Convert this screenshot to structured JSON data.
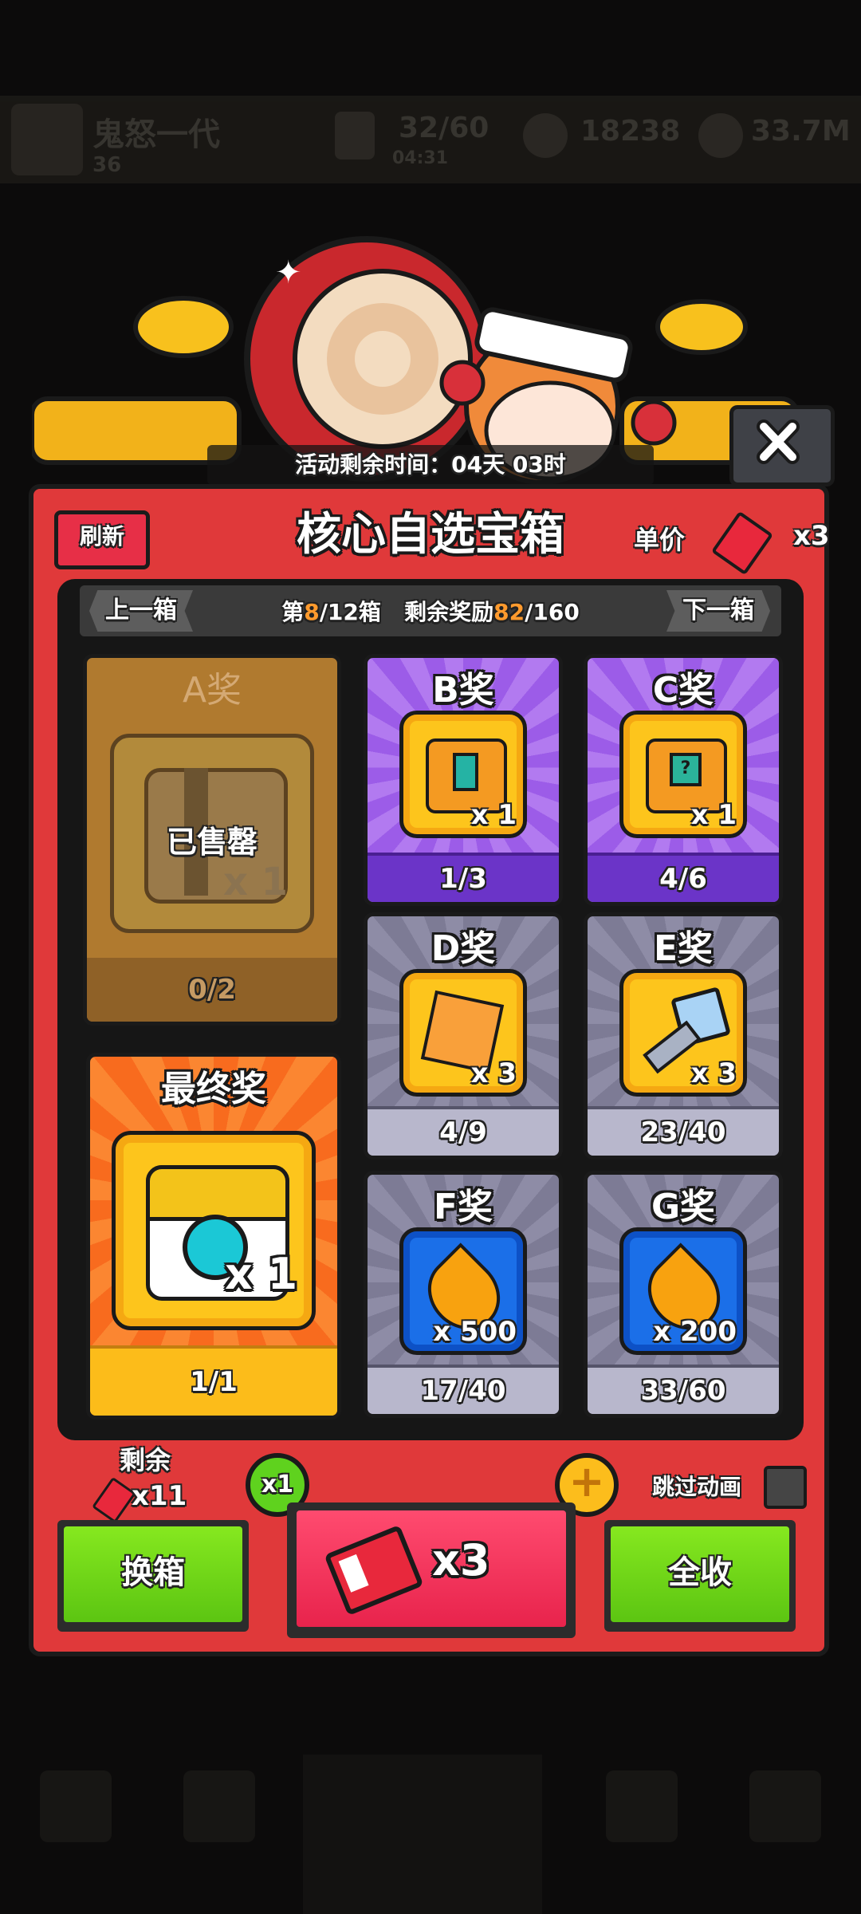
{
  "top_bar": {
    "player_name": "鬼怒一代",
    "level": "36",
    "energy": "32/60",
    "energy_timer": "04:31",
    "gems": "18238",
    "coins": "33.7M"
  },
  "banner": {
    "timer_text": "活动剩余时间：04天 03时"
  },
  "panel": {
    "refresh_label": "刷新",
    "title": "核心自选宝箱",
    "price_label": "单价",
    "price_value": "x3",
    "nav": {
      "prev_label": "上一箱",
      "next_label": "下一箱",
      "box_prefix": "第",
      "box_current": "8",
      "box_total": "/12箱",
      "reward_prefix": "剩余奖励",
      "reward_current": "82",
      "reward_total": "/160"
    },
    "prizes": [
      {
        "name": "A奖",
        "status": "已售罄",
        "qty": "x 1",
        "count": "0/2"
      },
      {
        "name": "B奖",
        "qty": "x 1",
        "count": "1/3"
      },
      {
        "name": "C奖",
        "qty": "x 1",
        "count": "4/6"
      },
      {
        "name": "D奖",
        "qty": "x 3",
        "count": "4/9"
      },
      {
        "name": "E奖",
        "qty": "x 3",
        "count": "23/40"
      },
      {
        "name": "F奖",
        "qty": "x 500",
        "count": "17/40"
      },
      {
        "name": "G奖",
        "qty": "x 200",
        "count": "33/60"
      }
    ],
    "final_prize": {
      "name": "最终奖",
      "qty": "x 1",
      "count": "1/1"
    }
  },
  "controls": {
    "remain_label": "剩余",
    "remain_value": "x11",
    "multiplier": "x1",
    "skip_label": "跳过动画",
    "swap_label": "换箱",
    "draw_value": "x3",
    "collect_label": "全收"
  },
  "colors": {
    "panel_red": "#e0393a",
    "purple_card": "#9c5ce8",
    "grey_card": "#7d7b95",
    "green_button": "#6fd519",
    "draw_button": "#ff3d63",
    "highlight_orange": "#ff9a2d"
  }
}
